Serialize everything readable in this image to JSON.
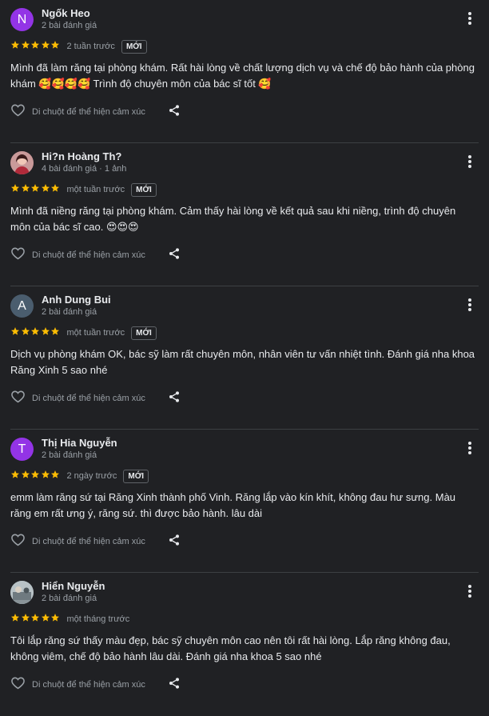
{
  "colors": {
    "background": "#202124",
    "star": "#fbbc04",
    "divider": "#3c4043",
    "muted_text": "#9aa0a6"
  },
  "reviews": [
    {
      "name": "Ngốk Heo",
      "meta": "2 bài đánh giá",
      "avatar_letter": "N",
      "avatar_color": "#9334e6",
      "rating": 5,
      "time": "2 tuần trước",
      "badge": "MỚI",
      "text": "Mình đã làm răng tại phòng khám. Rất hài lòng về chất lượng dịch vụ và chế độ bảo hành của phòng khám 🥰🥰🥰🥰 Trình độ chuyên môn của bác sĩ tốt 🥰",
      "reaction_label": "Di chuột để thể hiện cảm xúc"
    },
    {
      "name": "Hi?n Hoàng Th?",
      "meta": "4 bài đánh giá · 1 ảnh",
      "avatar_letter": "",
      "avatar_color": "#7b3b4a",
      "rating": 5,
      "time": "một tuần trước",
      "badge": "MỚI",
      "text": "Mình đã niềng răng tại phòng khám. Cảm thấy hài lòng về kết quả sau khi niềng, trình độ chuyên môn của bác sĩ cao. 😍😍😍",
      "reaction_label": "Di chuột để thể hiện cảm xúc"
    },
    {
      "name": "Anh Dung Bui",
      "meta": "2 bài đánh giá",
      "avatar_letter": "A",
      "avatar_color": "#4a5d6e",
      "rating": 5,
      "time": "một tuần trước",
      "badge": "MỚI",
      "text": "Dịch vụ phòng khám OK, bác sỹ làm rất chuyên môn, nhân viên tư vấn nhiệt tình. Đánh giá nha khoa Răng Xinh 5 sao nhé",
      "reaction_label": "Di chuột để thể hiện cảm xúc"
    },
    {
      "name": "Thị Hia Nguyễn",
      "meta": "2 bài đánh giá",
      "avatar_letter": "T",
      "avatar_color": "#9334e6",
      "rating": 5,
      "time": "2 ngày trước",
      "badge": "MỚI",
      "text": "emm làm răng sứ tại Răng Xinh thành phố Vinh. Răng lắp vào kín khít, không đau hư sưng. Màu răng em rất ưng ý, răng sứ. thì được bảo hành. lâu dài",
      "reaction_label": "Di chuột để thể hiện cảm xúc"
    },
    {
      "name": "Hiển Nguyễn",
      "meta": "2 bài đánh giá",
      "avatar_letter": "",
      "avatar_color": "#8a9499",
      "rating": 5,
      "time": "một tháng trước",
      "badge": "",
      "text": "Tôi lắp răng sứ thấy màu đẹp, bác sỹ chuyên môn cao nên tôi rất hài lòng. Lắp răng không đau, không viêm, chế độ bảo hành lâu dài. Đánh giá nha khoa 5 sao nhé",
      "reaction_label": "Di chuột để thể hiện cảm xúc"
    }
  ]
}
